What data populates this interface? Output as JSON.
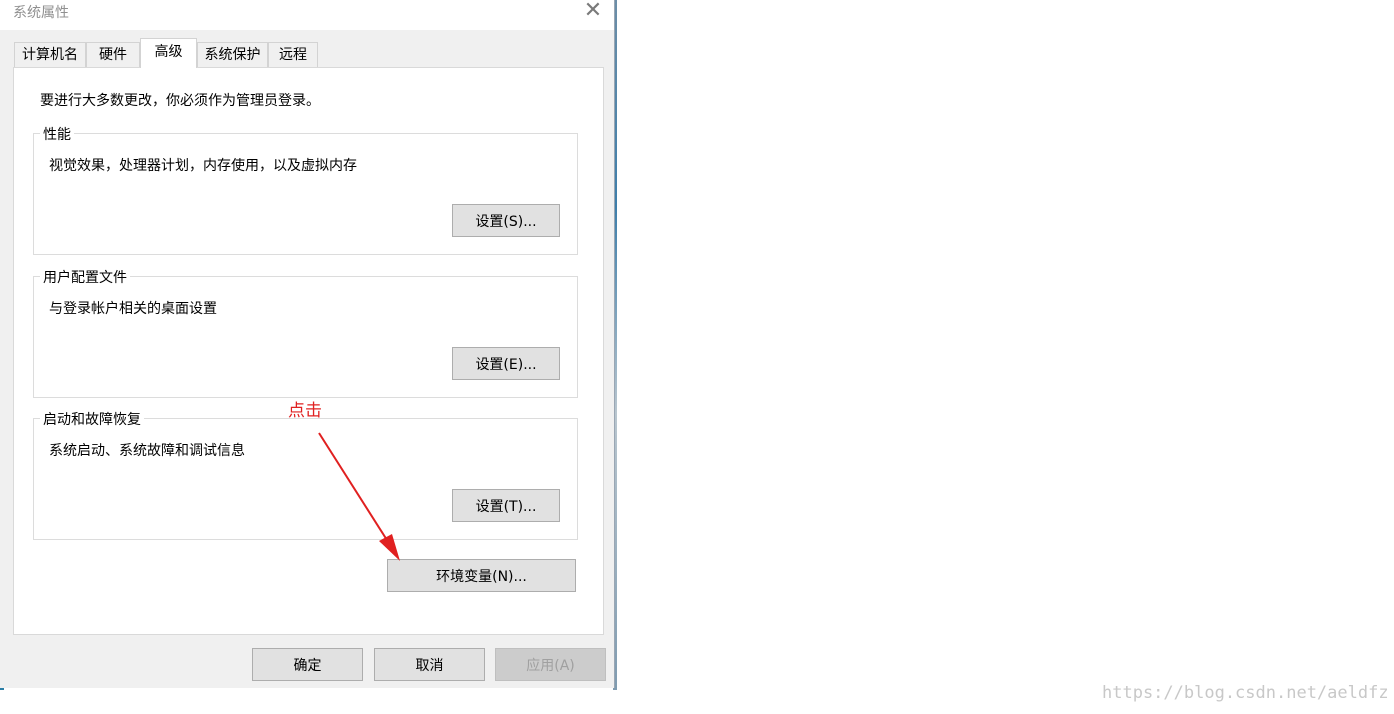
{
  "window": {
    "title": "系统属性"
  },
  "tabs": [
    {
      "label": "计算机名"
    },
    {
      "label": "硬件"
    },
    {
      "label": "高级"
    },
    {
      "label": "系统保护"
    },
    {
      "label": "远程"
    }
  ],
  "active_tab": "高级",
  "notice": "要进行大多数更改，你必须作为管理员登录。",
  "performance": {
    "title": "性能",
    "description": "视觉效果，处理器计划，内存使用，以及虚拟内存",
    "button": "设置(S)..."
  },
  "user_profiles": {
    "title": "用户配置文件",
    "description": "与登录帐户相关的桌面设置",
    "button": "设置(E)..."
  },
  "startup_recovery": {
    "title": "启动和故障恢复",
    "description": "系统启动、系统故障和调试信息",
    "button": "设置(T)..."
  },
  "env_button": "环境变量(N)...",
  "footer": {
    "ok": "确定",
    "cancel": "取消",
    "apply": "应用(A)"
  },
  "annotation": "点击",
  "watermark": "https://blog.csdn.net/aeldfz",
  "colors": {
    "annotation": "#e02020",
    "panel": "#ffffff",
    "dialog": "#f0f0f0",
    "button": "#e1e1e1"
  }
}
